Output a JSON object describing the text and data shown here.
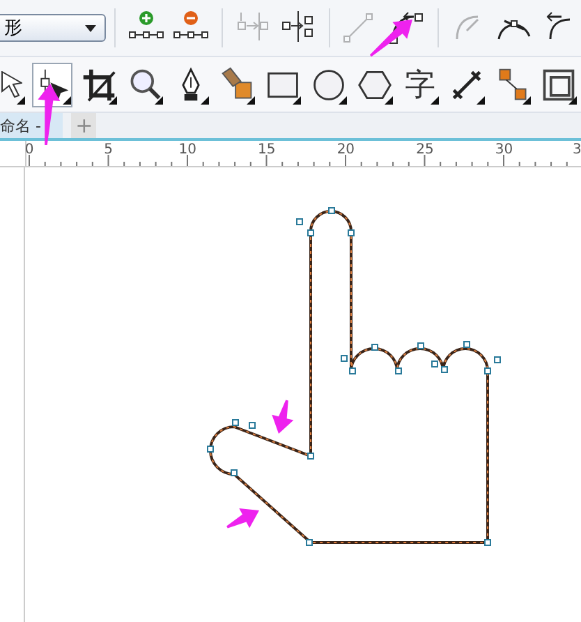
{
  "top_toolbar": {
    "dropdown": {
      "value": "形"
    },
    "tools": [
      {
        "kind": "add-node",
        "disabled": false
      },
      {
        "kind": "delete-node",
        "disabled": false
      },
      {
        "kind": "join-nodes",
        "disabled": true
      },
      {
        "kind": "break-curve",
        "disabled": false
      },
      {
        "kind": "to-line",
        "disabled": true
      },
      {
        "kind": "to-curve",
        "disabled": false
      },
      {
        "kind": "cusp",
        "disabled": true
      },
      {
        "kind": "smooth",
        "disabled": false
      },
      {
        "kind": "symmetric",
        "disabled": false
      }
    ]
  },
  "toolbox": [
    {
      "kind": "pick",
      "selected": false
    },
    {
      "kind": "shape",
      "selected": true
    },
    {
      "kind": "crop",
      "selected": false
    },
    {
      "kind": "zoom",
      "selected": false
    },
    {
      "kind": "pen",
      "selected": false
    },
    {
      "kind": "fill",
      "selected": false
    },
    {
      "kind": "rectangle",
      "selected": false
    },
    {
      "kind": "ellipse",
      "selected": false
    },
    {
      "kind": "polygon",
      "selected": false
    },
    {
      "kind": "text",
      "label": "字",
      "selected": false
    },
    {
      "kind": "dimension",
      "selected": false
    },
    {
      "kind": "connector",
      "selected": false
    },
    {
      "kind": "blend",
      "selected": false
    }
  ],
  "document_tabs": [
    {
      "label": "命名 -",
      "selected": true
    },
    {
      "label": "+",
      "selected": false
    }
  ],
  "ruler": {
    "labels": [
      "0",
      "5",
      "10",
      "15",
      "20",
      "25",
      "30",
      "3"
    ]
  }
}
